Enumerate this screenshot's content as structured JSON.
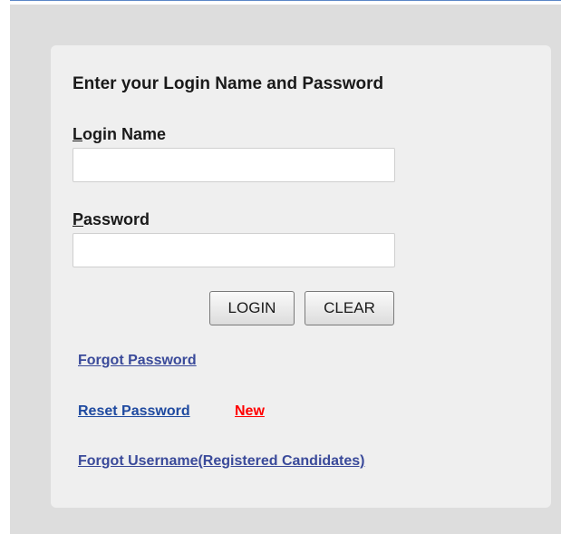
{
  "login_form": {
    "title": "Enter your Login Name and Password",
    "login_name": {
      "label_accesskey": "L",
      "label_rest": "ogin Name",
      "value": "",
      "placeholder": ""
    },
    "password": {
      "label_accesskey": "P",
      "label_rest": "assword",
      "value": "",
      "placeholder": ""
    },
    "buttons": {
      "login": "LOGIN",
      "clear": "CLEAR"
    },
    "links": {
      "forgot_password": "Forgot Password",
      "reset_password": "Reset Password",
      "reset_new_badge": "New",
      "forgot_username": "Forgot Username(Registered Candidates)"
    }
  },
  "colors": {
    "link": "#3a4a9a",
    "new_badge": "#ff0000",
    "panel_bg": "#efefef",
    "outer_bg": "#dddddd"
  }
}
